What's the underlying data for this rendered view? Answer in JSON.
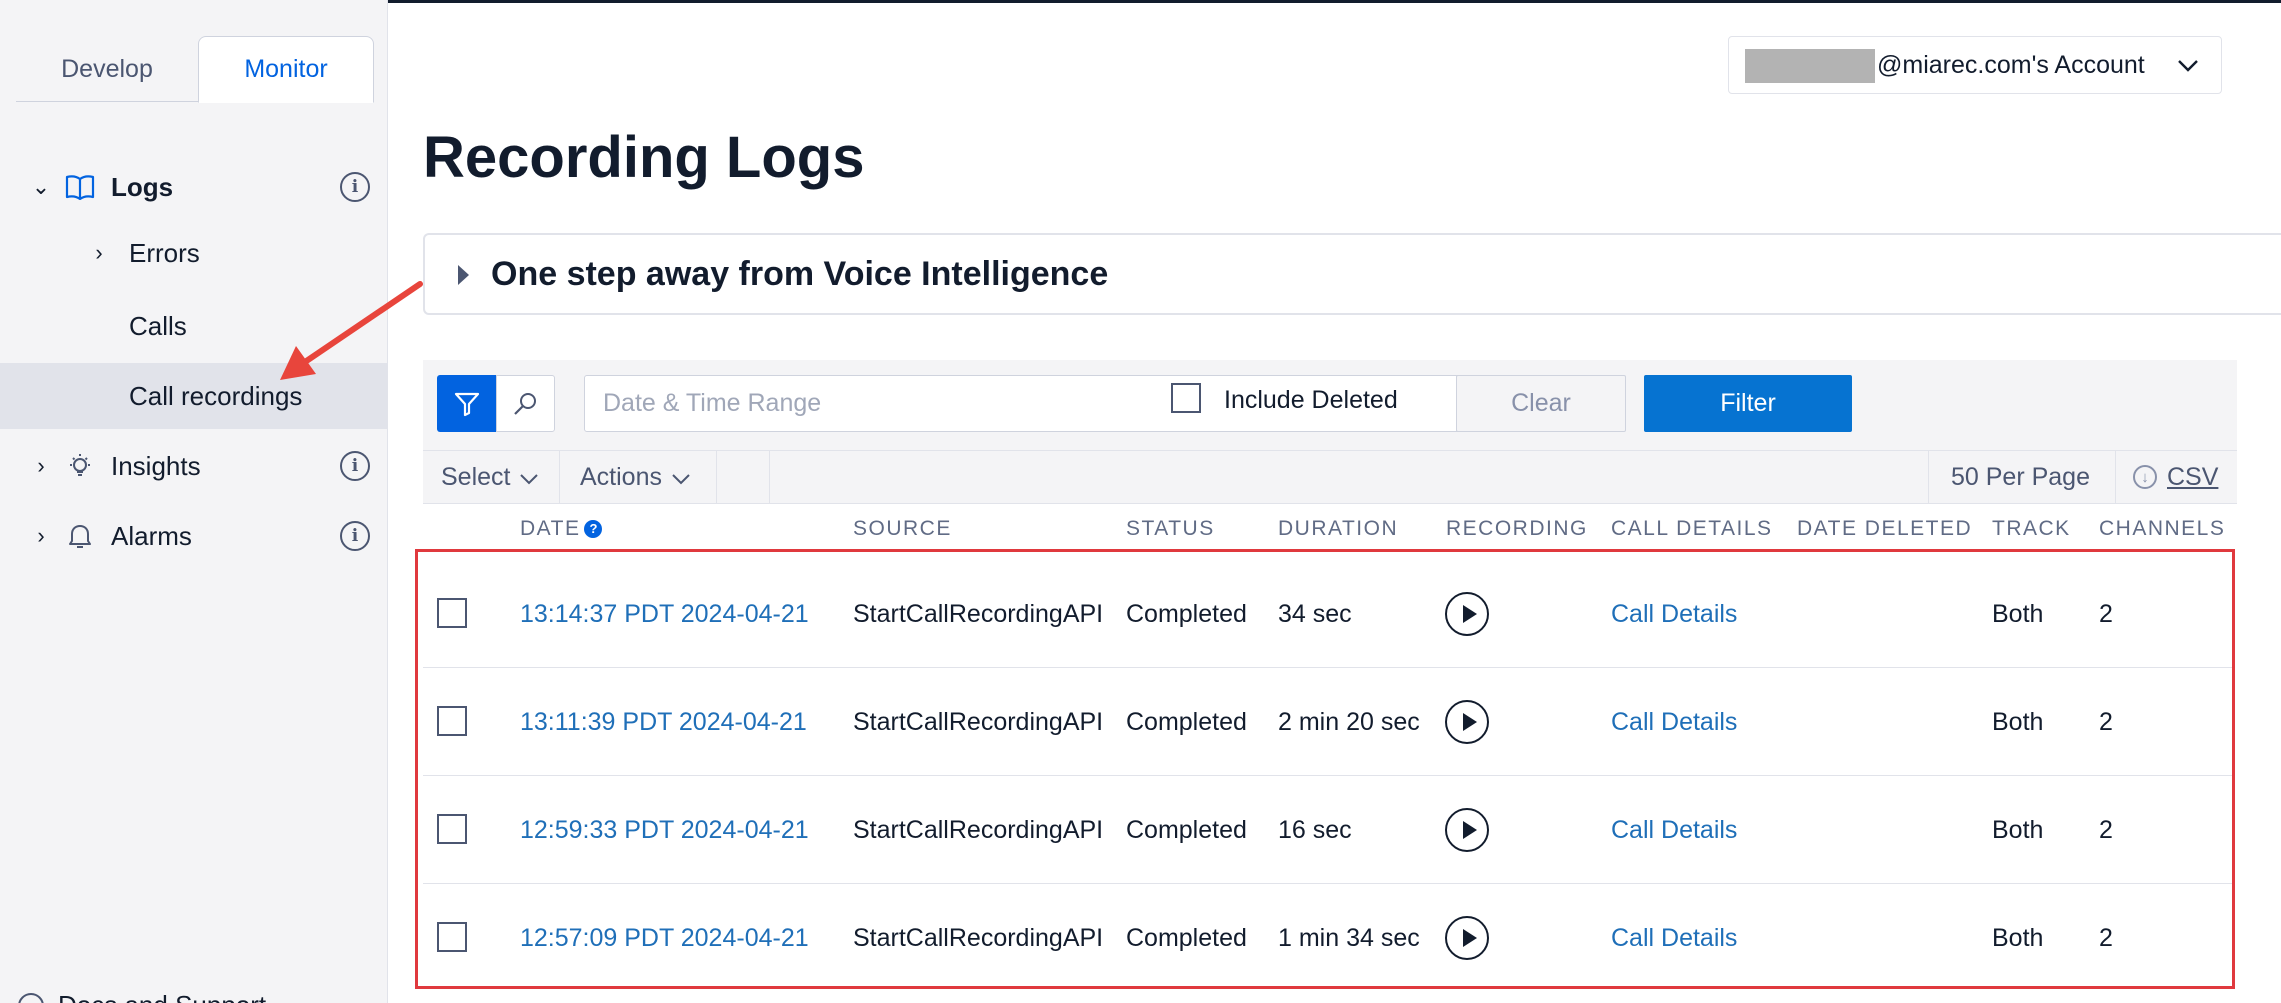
{
  "sidebar": {
    "tabs": {
      "develop": "Develop",
      "monitor": "Monitor"
    },
    "items": [
      {
        "label": "Logs",
        "icon": "book-icon"
      },
      {
        "label": "Errors"
      },
      {
        "label": "Calls"
      },
      {
        "label": "Call recordings"
      },
      {
        "label": "Insights",
        "icon": "lightbulb-icon"
      },
      {
        "label": "Alarms",
        "icon": "bell-icon"
      }
    ],
    "bottom_partial": "Docs and Support"
  },
  "header": {
    "account_suffix": "@miarec.com's Account"
  },
  "page": {
    "title": "Recording Logs",
    "disclosure_title": "One step away from Voice Intelligence"
  },
  "filters": {
    "date_placeholder": "Date & Time Range",
    "include_deleted_label": "Include Deleted",
    "clear_label": "Clear",
    "filter_label": "Filter"
  },
  "toolbar": {
    "select_label": "Select",
    "actions_label": "Actions",
    "per_page_label": "50 Per Page",
    "csv_label": "CSV"
  },
  "table": {
    "columns": [
      "DATE",
      "SOURCE",
      "STATUS",
      "DURATION",
      "RECORDING",
      "CALL DETAILS",
      "DATE DELETED",
      "TRACK",
      "CHANNELS"
    ],
    "rows": [
      {
        "date": "13:14:37 PDT 2024-04-21",
        "source": "StartCallRecordingAPI",
        "status": "Completed",
        "duration": "34 sec",
        "details": "Call Details",
        "date_deleted": "",
        "track": "Both",
        "channels": "2"
      },
      {
        "date": "13:11:39 PDT 2024-04-21",
        "source": "StartCallRecordingAPI",
        "status": "Completed",
        "duration": "2 min 20 sec",
        "details": "Call Details",
        "date_deleted": "",
        "track": "Both",
        "channels": "2"
      },
      {
        "date": "12:59:33 PDT 2024-04-21",
        "source": "StartCallRecordingAPI",
        "status": "Completed",
        "duration": "16 sec",
        "details": "Call Details",
        "date_deleted": "",
        "track": "Both",
        "channels": "2"
      },
      {
        "date": "12:57:09 PDT 2024-04-21",
        "source": "StartCallRecordingAPI",
        "status": "Completed",
        "duration": "1 min 34 sec",
        "details": "Call Details",
        "date_deleted": "",
        "track": "Both",
        "channels": "2"
      }
    ]
  },
  "annotations": {
    "arrow_color": "#e8453c",
    "highlight_color": "#e0393e"
  },
  "colors": {
    "brand_blue": "#0263e0",
    "filter_button": "#0673d1",
    "link": "#1f6fb8"
  }
}
